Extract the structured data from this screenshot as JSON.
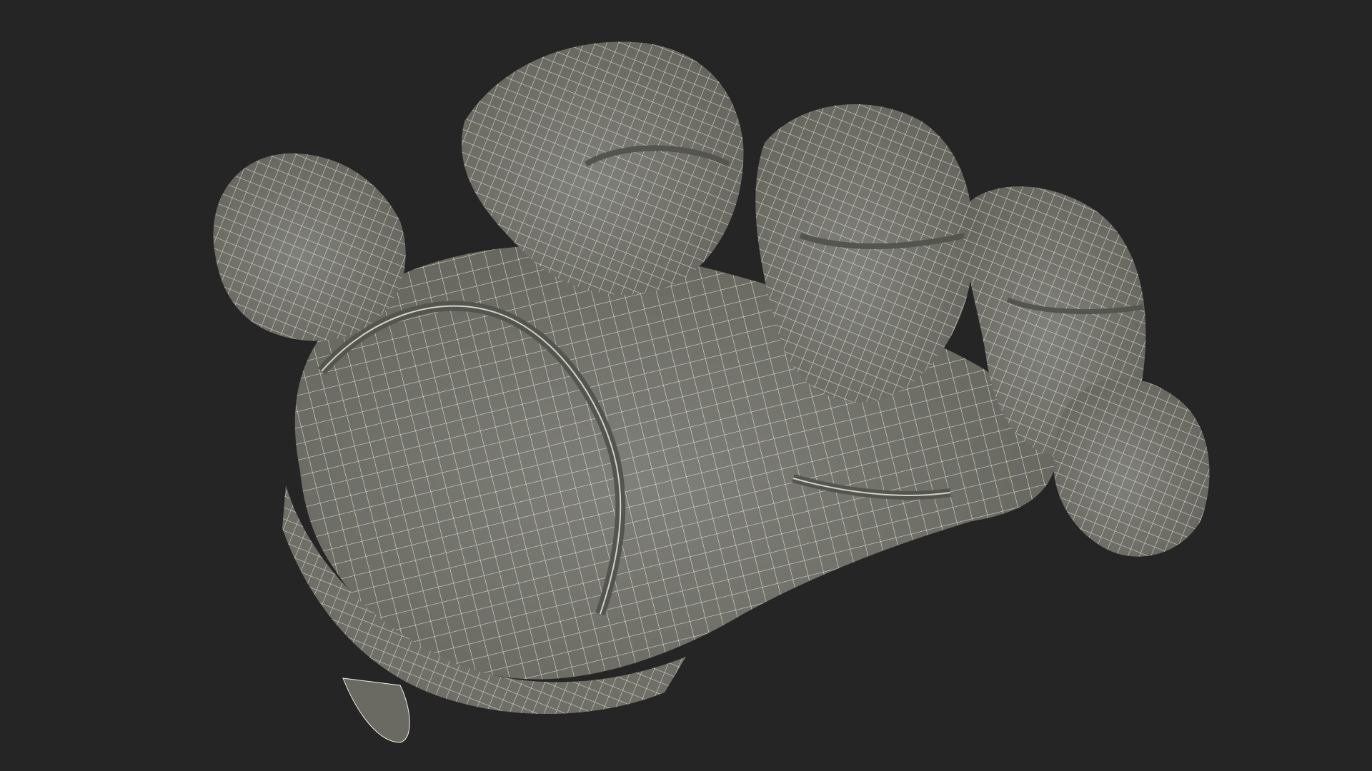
{
  "scene": {
    "subject": "glove-wireframe-model",
    "background_color": "#252525",
    "surface_color": "#7b7b72",
    "surface_shadow_color": "#5f5f58",
    "wire_color": "#f2f2e6"
  }
}
